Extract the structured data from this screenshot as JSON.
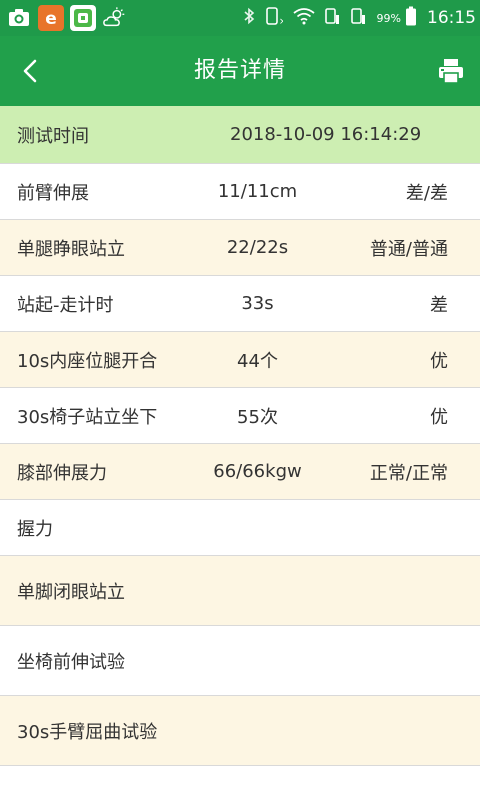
{
  "statusbar": {
    "battery_pct": "99%",
    "time": "16:15"
  },
  "appbar": {
    "title": "报告详情"
  },
  "header_row": {
    "label": "测试时间",
    "datetime": "2018-10-09 16:14:29"
  },
  "rows": [
    {
      "label": "前臂伸展",
      "value": "11/11cm",
      "grade": "差/差"
    },
    {
      "label": "单腿睁眼站立",
      "value": "22/22s",
      "grade": "普通/普通"
    },
    {
      "label": "站起-走计时",
      "value": "33s",
      "grade": "差"
    },
    {
      "label": "10s内座位腿开合",
      "value": "44个",
      "grade": "优"
    },
    {
      "label": "30s椅子站立坐下",
      "value": "55次",
      "grade": "优"
    },
    {
      "label": "膝部伸展力",
      "value": "66/66kgw",
      "grade": "正常/正常"
    },
    {
      "label": "握力",
      "value": "",
      "grade": ""
    },
    {
      "label": "单脚闭眼站立",
      "value": "",
      "grade": ""
    },
    {
      "label": "坐椅前伸试验",
      "value": "",
      "grade": ""
    },
    {
      "label": "30s手臂屈曲试验",
      "value": "",
      "grade": ""
    }
  ],
  "colors": {
    "statusbar": "#1f9a4a",
    "appbar": "#21a04b",
    "header_row": "#cdeeb2",
    "cream_row": "#fdf6e3"
  }
}
